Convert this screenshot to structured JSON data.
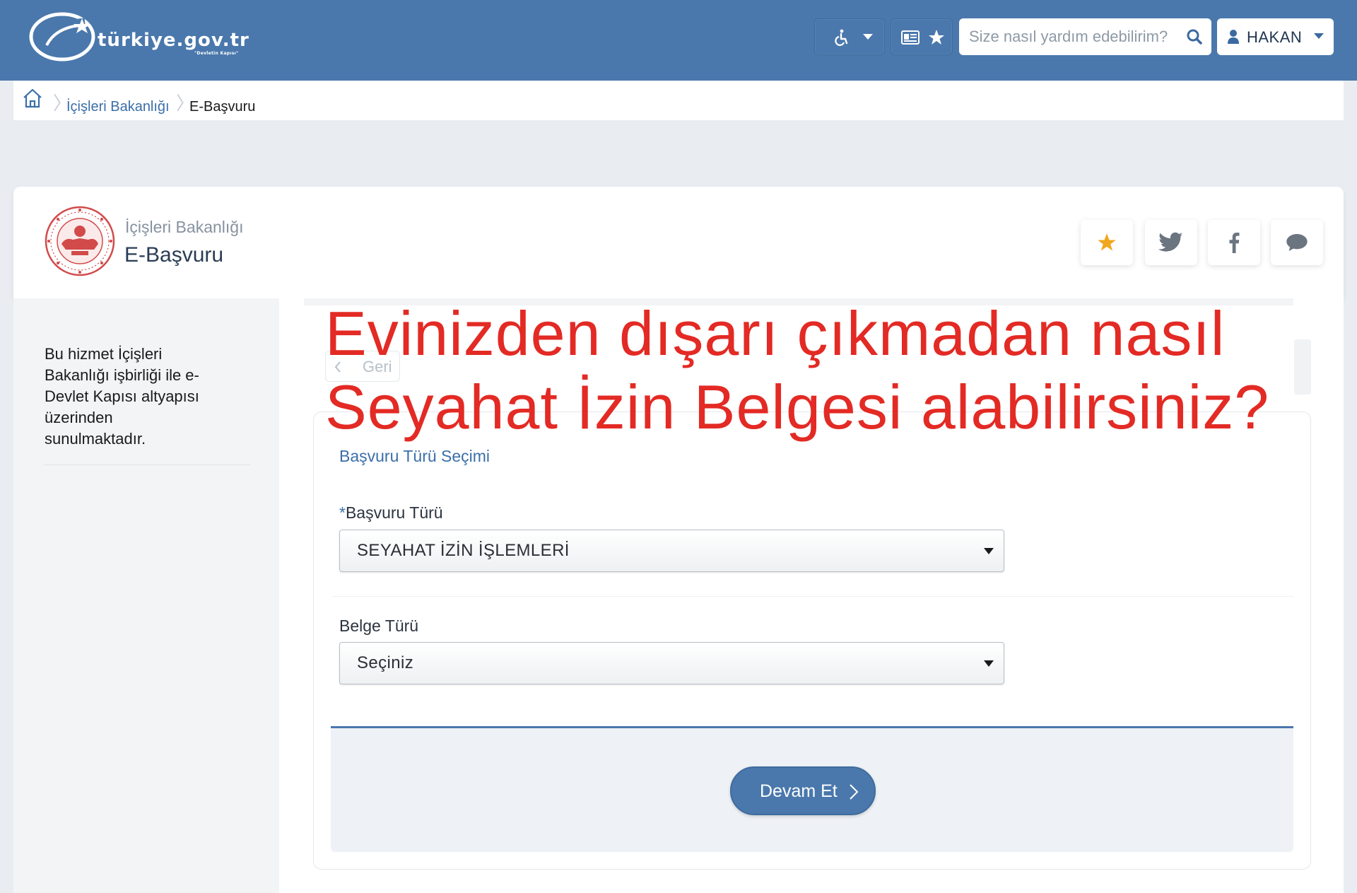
{
  "header": {
    "logo_text": "türkiye.gov.tr",
    "logo_subtext": "\"Devletin Kapısı\"",
    "accessibility_icon": "wheelchair-icon",
    "card_icon": "id-card-icon",
    "favorites_icon": "star-icon",
    "search_placeholder": "Size nasıl yardım edebilirim?",
    "user_name": "HAKAN",
    "bg_color": "#4a78ac"
  },
  "breadcrumb": {
    "home_icon": "home-icon",
    "items": [
      {
        "label": "İçişleri Bakanlığı"
      },
      {
        "label": "E-Başvuru"
      }
    ]
  },
  "service": {
    "ministry": "İçişleri Bakanlığı",
    "title": "E-Başvuru",
    "actions": [
      "star-icon",
      "twitter-icon",
      "facebook-icon",
      "comment-icon"
    ]
  },
  "sidebar": {
    "info": "Bu hizmet İçişleri Bakanlığı işbirliği ile e-Devlet Kapısı altyapısı üzerinden sunulmaktadır."
  },
  "main": {
    "back_label": "Geri",
    "section_title": "Başvuru Türü Seçimi",
    "fields": [
      {
        "label": "Başvuru Türü",
        "required_mark": "*",
        "value": "SEYAHAT İZİN İŞLEMLERİ"
      },
      {
        "label": "Belge Türü",
        "value": "Seçiniz"
      }
    ],
    "continue_label": "Devam Et",
    "accent_color": "#3b6fa8"
  },
  "overlay": {
    "line1": "Evinizden dışarı çıkmadan nasıl",
    "line2": "Seyahat İzin Belgesi alabilirsiniz?",
    "color": "#e32a24"
  }
}
